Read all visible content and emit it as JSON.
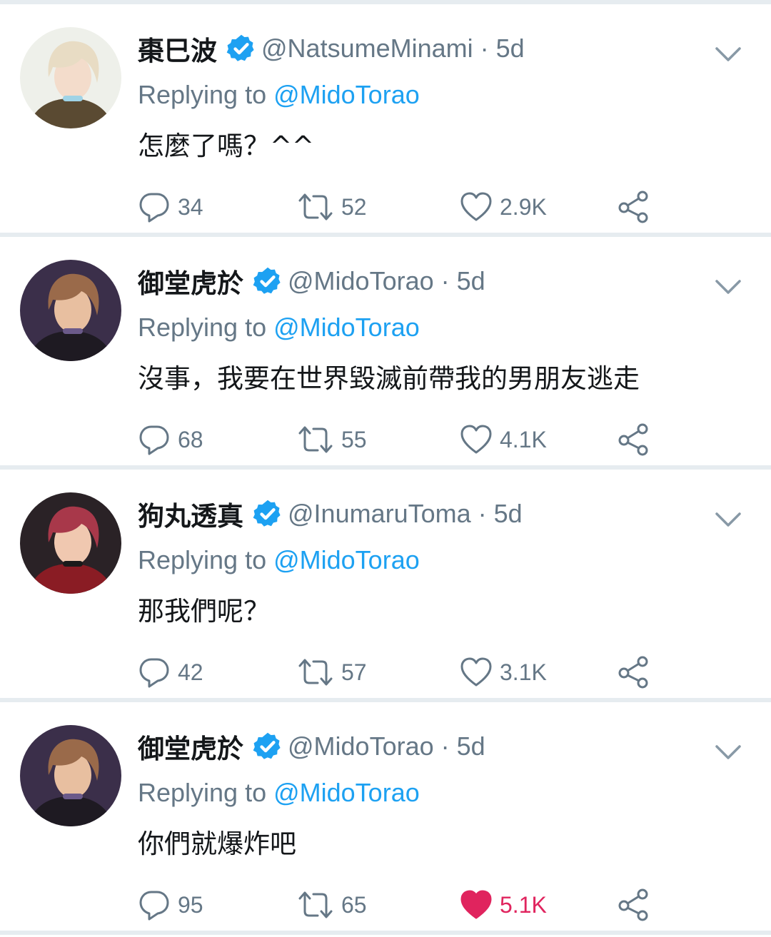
{
  "tweets": [
    {
      "name": "棗巳波",
      "handle": "@NatsumeMinami",
      "dot": "·",
      "time": "5d",
      "replying_prefix": "Replying to ",
      "replying_to": "@MidoTorao",
      "text": "怎麼了嗎？^^",
      "replies": "34",
      "retweets": "52",
      "likes": "2.9K",
      "liked": false,
      "avatar_palette": {
        "bg": "#eef0ea",
        "hair": "#e8dcc4",
        "skin": "#f3dccb",
        "cloth": "#5a4a32",
        "accent": "#9fd3e6"
      }
    },
    {
      "name": "御堂虎於",
      "handle": "@MidoTorao",
      "dot": "·",
      "time": "5d",
      "replying_prefix": "Replying to ",
      "replying_to": "@MidoTorao",
      "text": "沒事，我要在世界毀滅前帶我的男朋友逃走",
      "replies": "68",
      "retweets": "55",
      "likes": "4.1K",
      "liked": false,
      "avatar_palette": {
        "bg": "#3b2f4a",
        "hair": "#9a6a4a",
        "skin": "#e8bfa0",
        "cloth": "#1e1a22",
        "accent": "#6b5a8a"
      }
    },
    {
      "name": "狗丸透真",
      "handle": "@InumaruToma",
      "dot": "·",
      "time": "5d",
      "replying_prefix": "Replying to ",
      "replying_to": "@MidoTorao",
      "text": "那我們呢？",
      "replies": "42",
      "retweets": "57",
      "likes": "3.1K",
      "liked": false,
      "avatar_palette": {
        "bg": "#2a2226",
        "hair": "#a8384a",
        "skin": "#f0c8b0",
        "cloth": "#8a1c24",
        "accent": "#1a1a1a"
      }
    },
    {
      "name": "御堂虎於",
      "handle": "@MidoTorao",
      "dot": "·",
      "time": "5d",
      "replying_prefix": "Replying to ",
      "replying_to": "@MidoTorao",
      "text": "你們就爆炸吧",
      "replies": "95",
      "retweets": "65",
      "likes": "5.1K",
      "liked": true,
      "avatar_palette": {
        "bg": "#3b2f4a",
        "hair": "#9a6a4a",
        "skin": "#e8bfa0",
        "cloth": "#1e1a22",
        "accent": "#6b5a8a"
      }
    }
  ],
  "icons": {
    "verified": "verified-badge-icon",
    "chevron": "chevron-down-icon",
    "reply": "reply-icon",
    "retweet": "retweet-icon",
    "like": "heart-icon",
    "share": "share-icon"
  },
  "colors": {
    "name": "#14171a",
    "muted": "#657786",
    "mention": "#1da1f2",
    "verified": "#1da1f2",
    "liked": "#e0245e",
    "divider": "#e6ecf0"
  }
}
